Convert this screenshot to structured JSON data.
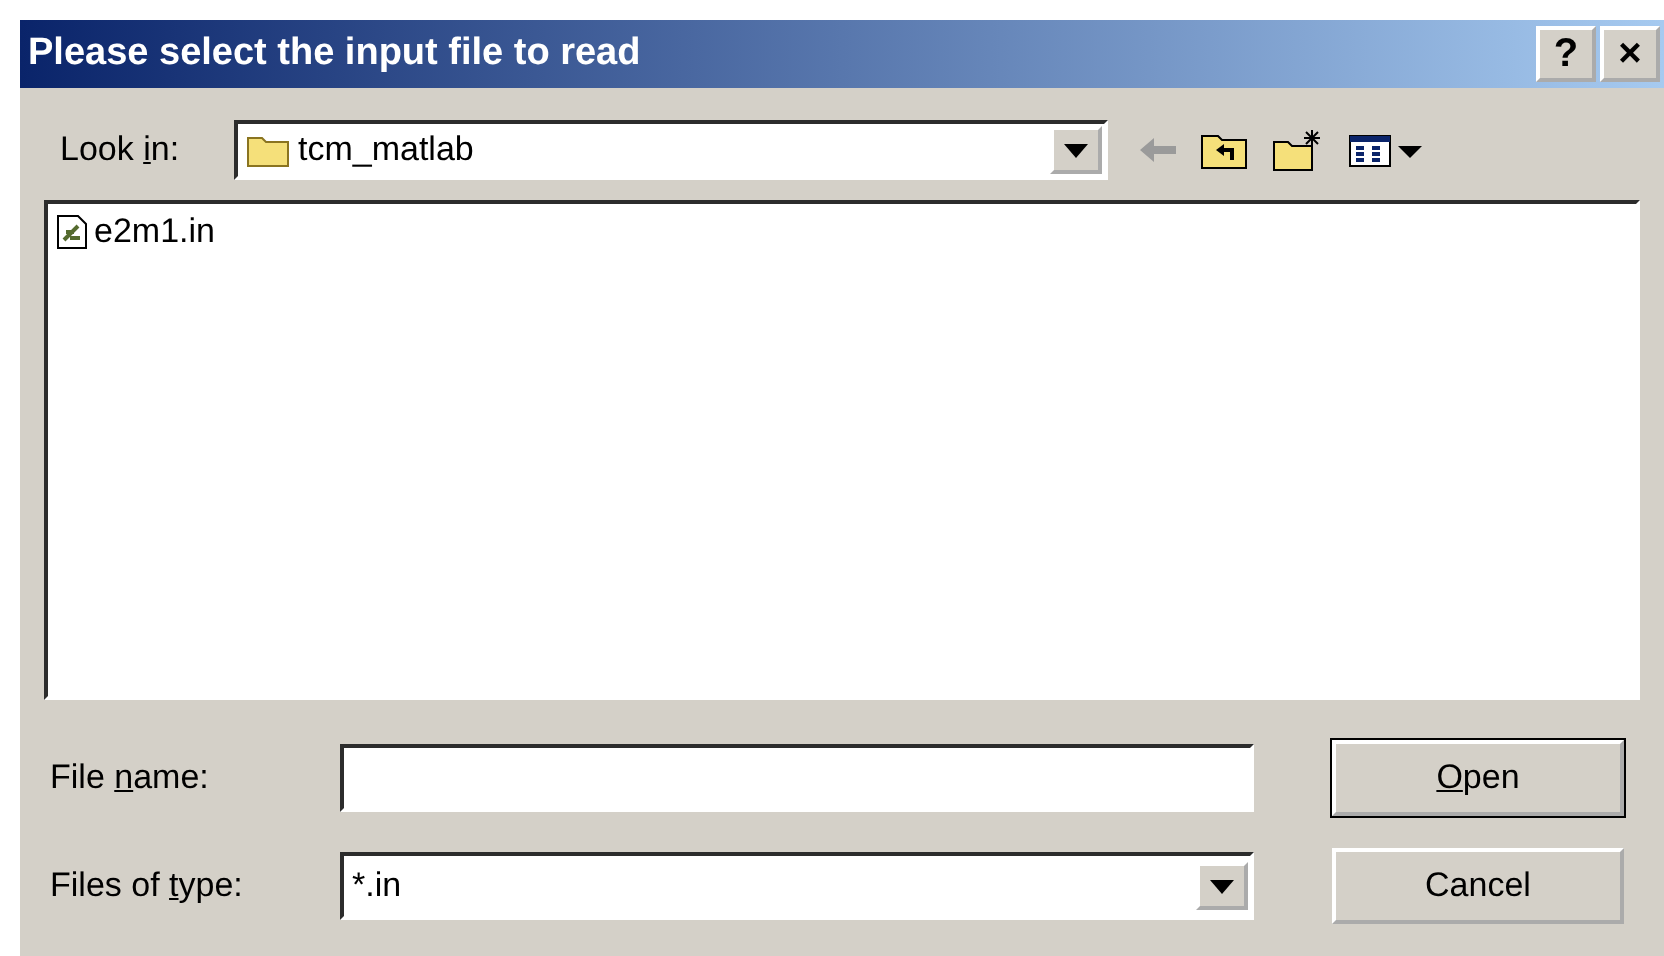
{
  "window": {
    "title": "Please select the input file to read",
    "title_buttons": [
      "?",
      "×"
    ]
  },
  "look_in": {
    "label_parts": {
      "before": "Look ",
      "key": "i",
      "after": "n:"
    },
    "value": "tcm_matlab"
  },
  "files": [
    {
      "name": "e2m1.in",
      "selected": false
    }
  ],
  "file_name": {
    "label_parts": {
      "before": "File ",
      "key": "n",
      "after": "ame:"
    }
  },
  "file_type": {
    "label_parts": {
      "before": "Files of ",
      "key": "t",
      "after": "ype:"
    },
    "value": "*.in"
  },
  "buttons": [
    {
      "label_parts": {
        "key": "O",
        "after": "pen"
      },
      "default": true
    },
    {
      "label_parts": {
        "before": "Cancel"
      },
      "default": false
    }
  ]
}
